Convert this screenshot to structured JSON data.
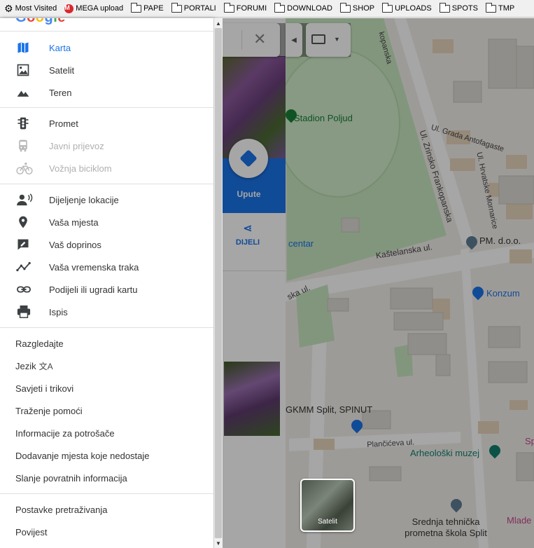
{
  "bookmarks": [
    {
      "label": "Most Visited",
      "icon": "gear-icon"
    },
    {
      "label": "MEGA upload",
      "icon": "mega-icon"
    },
    {
      "label": "PAPE",
      "icon": "folder-icon"
    },
    {
      "label": "PORTALI",
      "icon": "folder-icon"
    },
    {
      "label": "FORUMI",
      "icon": "folder-icon"
    },
    {
      "label": "DOWNLOAD",
      "icon": "folder-icon"
    },
    {
      "label": "SHOP",
      "icon": "folder-icon"
    },
    {
      "label": "UPLOADS",
      "icon": "folder-icon"
    },
    {
      "label": "SPOTS",
      "icon": "folder-icon"
    },
    {
      "label": "TMP",
      "icon": "folder-icon"
    }
  ],
  "menu": {
    "map_types": [
      {
        "label": "Karta",
        "icon": "map-icon",
        "active": true
      },
      {
        "label": "Satelit",
        "icon": "satellite-icon"
      },
      {
        "label": "Teren",
        "icon": "terrain-icon"
      }
    ],
    "layers": [
      {
        "label": "Promet",
        "icon": "traffic-icon"
      },
      {
        "label": "Javni prijevoz",
        "icon": "transit-icon",
        "disabled": true
      },
      {
        "label": "Vožnja biciklom",
        "icon": "bicycle-icon",
        "disabled": true
      }
    ],
    "personal": [
      {
        "label": "Dijeljenje lokacije",
        "icon": "location-sharing-icon"
      },
      {
        "label": "Vaša mjesta",
        "icon": "place-pin-icon"
      },
      {
        "label": "Vaš doprinos",
        "icon": "contribution-icon"
      },
      {
        "label": "Vaša vremenska traka",
        "icon": "timeline-icon"
      },
      {
        "label": "Podijeli ili ugradi kartu",
        "icon": "link-icon"
      },
      {
        "label": "Ispis",
        "icon": "print-icon"
      }
    ],
    "links": [
      {
        "label": "Razgledajte"
      },
      {
        "label": "Jezik",
        "icon": "translate-icon"
      },
      {
        "label": "Savjeti i trikovi"
      },
      {
        "label": "Traženje pomoći"
      },
      {
        "label": "Informacije za potrošače"
      },
      {
        "label": "Dodavanje mjesta koje nedostaje"
      },
      {
        "label": "Slanje povratnih informacija"
      }
    ],
    "footer": [
      {
        "label": "Postavke pretraživanja"
      },
      {
        "label": "Povijest"
      }
    ]
  },
  "panel": {
    "directions_label": "Upute",
    "share_label": "DIJELI"
  },
  "map": {
    "places": [
      {
        "label": "Stadion Poljud",
        "color": "#188038"
      },
      {
        "label": "centar",
        "color": "#1a73e8"
      },
      {
        "label": "PM. d.o.o.",
        "color": "#333333"
      },
      {
        "label": "Konzum",
        "color": "#1a73e8"
      },
      {
        "label": "GKMM Split, SPINUT",
        "color": "#333333"
      },
      {
        "label": "Arheološki muzej",
        "color": "#12806d"
      },
      {
        "label": "Srednja tehnička prometna škola Split",
        "color": "#333333"
      },
      {
        "label": "Sp",
        "color": "#c5478a"
      },
      {
        "label": "Mlade",
        "color": "#c5478a"
      }
    ],
    "roads": [
      {
        "label": "kopanska"
      },
      {
        "label": "Ul. Grada Antofagaste"
      },
      {
        "label": "Ul. Zrinsko Frankopanska"
      },
      {
        "label": "Ul. Hrvatske Mornarice"
      },
      {
        "label": "Kaštelanska ul."
      },
      {
        "label": "ska ul."
      },
      {
        "label": "Plančićeva ul."
      }
    ],
    "layer_toggle_label": "Satelit"
  }
}
